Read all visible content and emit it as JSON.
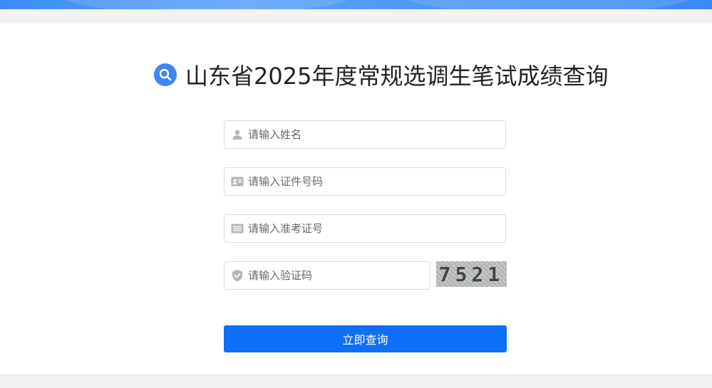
{
  "header": {
    "title": "山东省2025年度常规选调生笔试成绩查询",
    "title_icon": "search-icon",
    "brand_color": "#3e86f5"
  },
  "form": {
    "name": {
      "placeholder": "请输入姓名",
      "icon": "user-icon"
    },
    "id_number": {
      "placeholder": "请输入证件号码",
      "icon": "id-card-icon"
    },
    "ticket_number": {
      "placeholder": "请输入准考证号",
      "icon": "ticket-icon"
    },
    "captcha": {
      "placeholder": "请输入验证码",
      "icon": "shield-icon",
      "image_text": "7521"
    },
    "submit_label": "立即查询",
    "submit_color": "#0f6ef8"
  }
}
